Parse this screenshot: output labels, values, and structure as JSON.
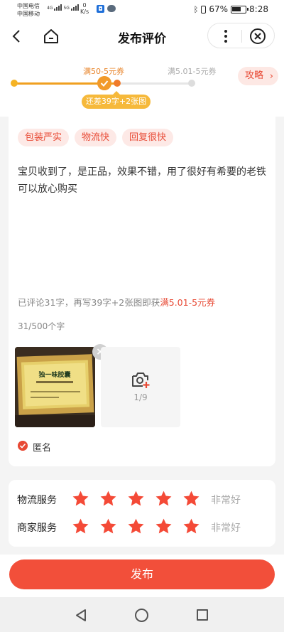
{
  "status_bar": {
    "carrier1": "中国电信",
    "carrier2": "中国移动",
    "net1": "4G",
    "net2": "5G",
    "speed_value": "0",
    "speed_unit": "K/s",
    "battery": "67%",
    "time": "8:28"
  },
  "header": {
    "title": "发布评价"
  },
  "progress": {
    "milestone1": "满50-5元券",
    "milestone2": "满5.01-5元券",
    "tip": "还差39字+2张图",
    "strategy_label": "攻略",
    "colors": {
      "active": "#f0a020",
      "accent": "#e84a35"
    }
  },
  "review": {
    "tags": [
      "包装严实",
      "物流快",
      "回复很快"
    ],
    "text": "宝贝收到了，是正品，效果不错，用了很好有希要的老铁可以放心购买",
    "hint_prefix": "已评论31字，再写39字+2张图即获",
    "hint_highlight": "满5.01-5元券",
    "counter": "31/500个字",
    "photo_caption": "独一味胶囊",
    "upload_count": "1/9",
    "anonymous_label": "匿名",
    "anonymous_checked": true
  },
  "ratings": [
    {
      "label": "物流服务",
      "stars": 5,
      "max": 5,
      "text": "非常好"
    },
    {
      "label": "商家服务",
      "stars": 5,
      "max": 5,
      "text": "非常好"
    }
  ],
  "actions": {
    "publish_label": "发布",
    "primary_color": "#f24f3a"
  }
}
